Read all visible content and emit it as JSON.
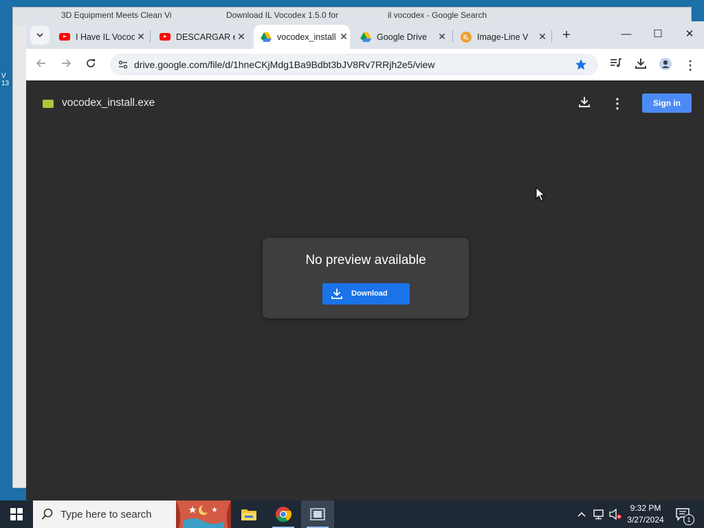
{
  "background_window": {
    "tabs": [
      {
        "label": "3D Equipment Meets Clean Vi"
      },
      {
        "label": "Download IL Vocodex 1.5.0 for"
      },
      {
        "label": "il vocodex - Google Search"
      }
    ],
    "desktop_icon_label": "V\n13"
  },
  "browser": {
    "tabs": [
      {
        "label": "I Have IL Vocodex",
        "icon": "youtube-icon"
      },
      {
        "label": "DESCARGAR e",
        "icon": "youtube-icon"
      },
      {
        "label": "vocodex_install",
        "icon": "google-drive-icon"
      },
      {
        "label": "Google Drive",
        "icon": "google-drive-icon"
      },
      {
        "label": "Image-Line V",
        "icon": "image-line-icon"
      }
    ],
    "active_tab_index": 2,
    "url": "drive.google.com/file/d/1hneCKjMdg1Ba9Bdbt3bJV8Rv7RRjh2e5/view"
  },
  "drive": {
    "file_name": "vocodex_install.exe",
    "sign_in_label": "Sign in",
    "preview_message": "No preview available",
    "download_label": "Download"
  },
  "taskbar": {
    "search_placeholder": "Type here to search",
    "time": "9:32 PM",
    "date": "3/27/2024",
    "notification_count": "1"
  },
  "colors": {
    "accent_blue": "#1a73e8",
    "sign_in_blue": "#4c8bf5",
    "drive_background": "#2d2d2d"
  }
}
